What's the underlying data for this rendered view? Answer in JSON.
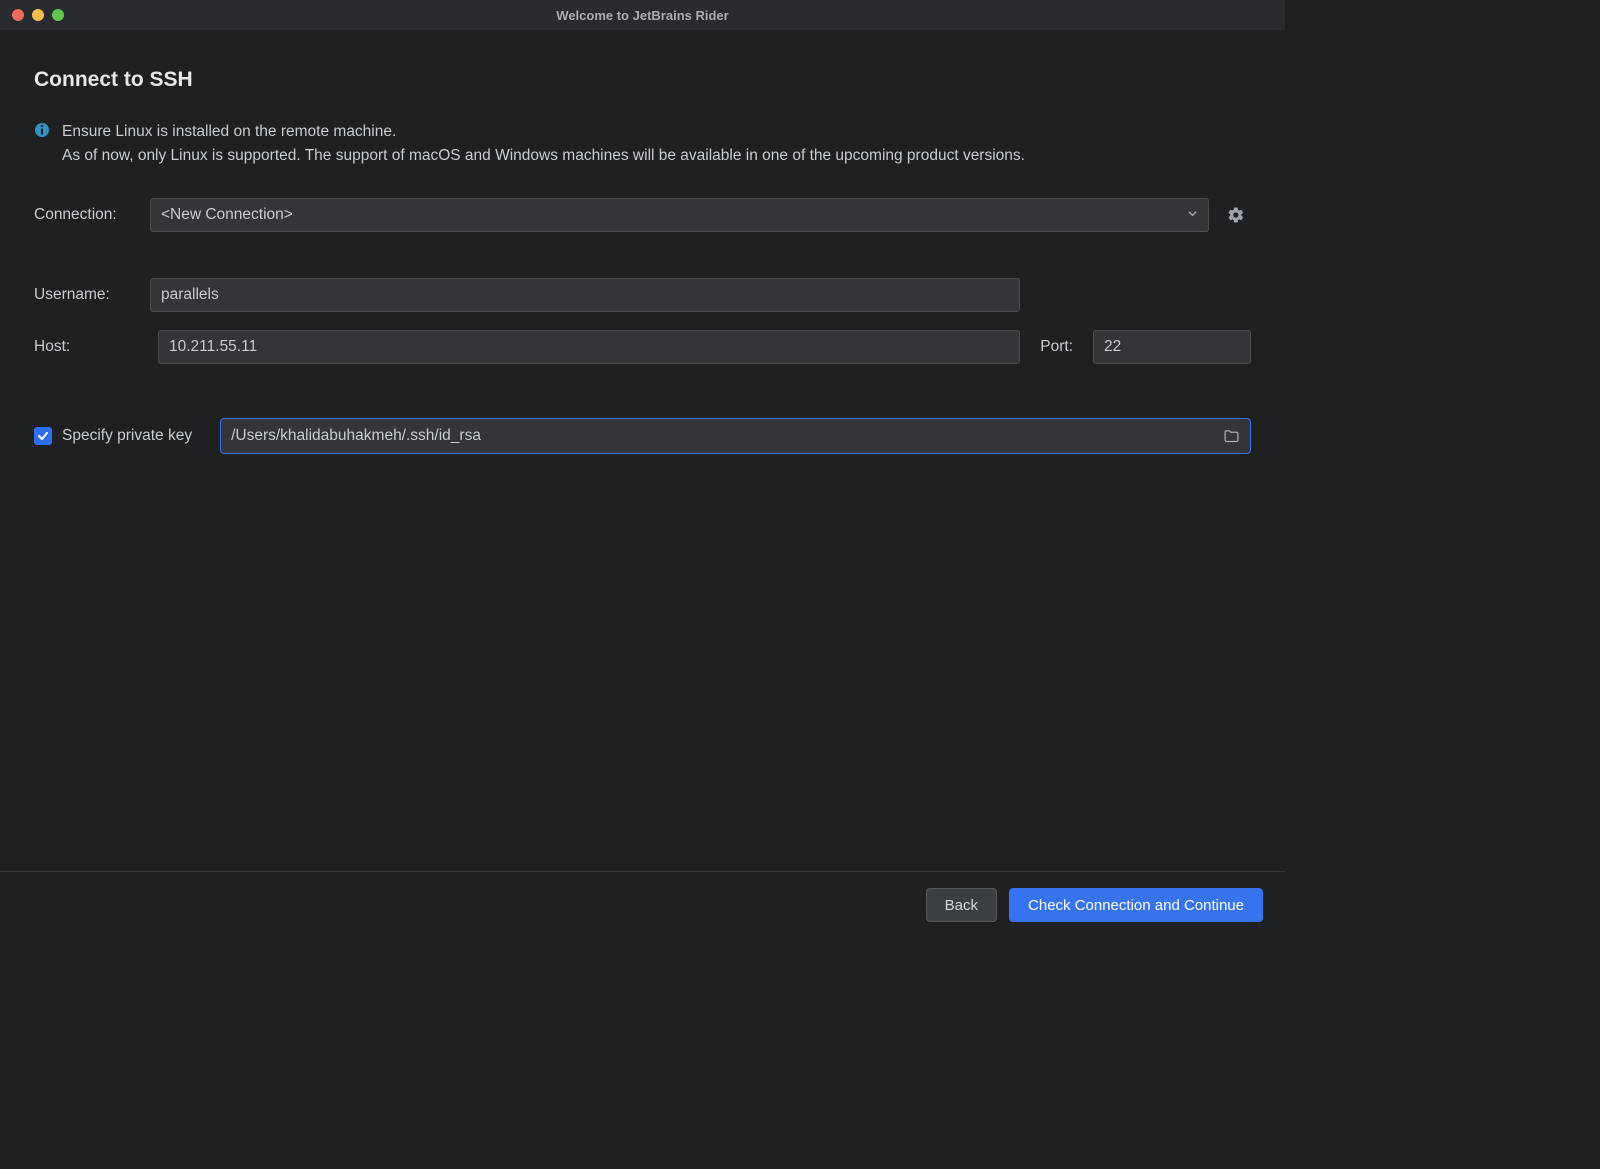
{
  "window": {
    "title": "Welcome to JetBrains Rider"
  },
  "page": {
    "heading": "Connect to SSH"
  },
  "info": {
    "line1": "Ensure Linux is installed on the remote machine.",
    "line2": "As of now, only Linux is supported. The support of macOS and Windows machines will be available in one of the upcoming product versions."
  },
  "form": {
    "connection_label": "Connection:",
    "connection_value": "<New Connection>",
    "username_label": "Username:",
    "username_value": "parallels",
    "host_label": "Host:",
    "host_value": "10.211.55.11",
    "port_label": "Port:",
    "port_value": "22",
    "specify_key_label": "Specify private key",
    "specify_key_checked": true,
    "key_path_value": "/Users/khalidabuhakmeh/.ssh/id_rsa"
  },
  "footer": {
    "back_label": "Back",
    "continue_label": "Check Connection and Continue"
  },
  "colors": {
    "accent": "#3573f0",
    "bg": "#1e2022"
  }
}
